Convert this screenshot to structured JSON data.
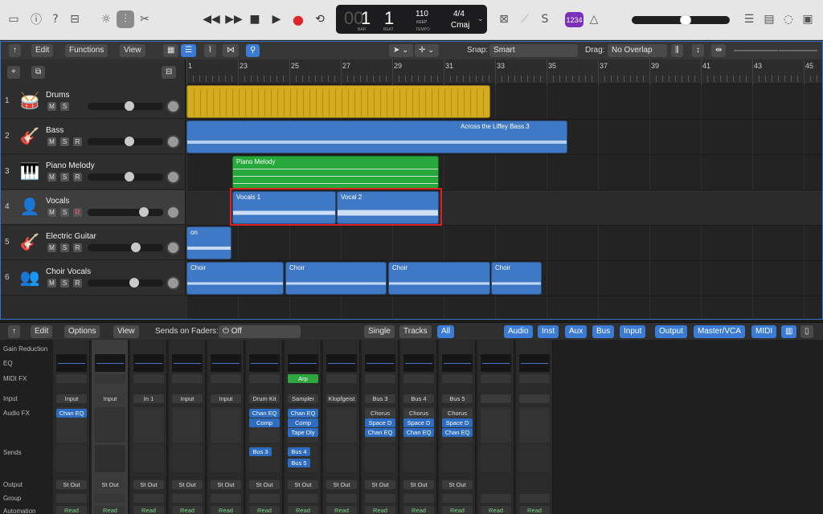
{
  "transport": {
    "bar": "1",
    "beat": "1",
    "bar_dim": "00",
    "bar_label": "BAR",
    "beat_label": "BEAT",
    "tempo": "110",
    "tempo_mode": "KEEP",
    "tempo_label": "TEMPO",
    "time_sig": "4/4",
    "key": "Cmaj",
    "count_in": "1234"
  },
  "arrange": {
    "edit": "Edit",
    "functions": "Functions",
    "view": "View",
    "snap_label": "Snap:",
    "snap_value": "Smart",
    "drag_label": "Drag:",
    "drag_value": "No Overlap"
  },
  "ruler": [
    "1",
    "23",
    "25",
    "27",
    "29",
    "31",
    "33",
    "35",
    "37",
    "39",
    "41",
    "43",
    "45"
  ],
  "tracks": [
    {
      "num": "1",
      "name": "Drums",
      "icon": "drum-kit-icon",
      "glyph": "🥁",
      "rec": false
    },
    {
      "num": "2",
      "name": "Bass",
      "icon": "bass-guitar-icon",
      "glyph": "🎸",
      "rec": false
    },
    {
      "num": "3",
      "name": "Piano Melody",
      "icon": "piano-icon",
      "glyph": "🎹",
      "rec": false
    },
    {
      "num": "4",
      "name": "Vocals",
      "icon": "vocalist-icon",
      "glyph": "👤",
      "rec": true
    },
    {
      "num": "5",
      "name": "Electric Guitar",
      "icon": "electric-guitar-icon",
      "glyph": "🎸",
      "rec": false
    },
    {
      "num": "6",
      "name": "Choir Vocals",
      "icon": "choir-icon",
      "glyph": "👥",
      "rec": false
    }
  ],
  "regions": {
    "bass": "Across the Liffey Bass.3",
    "piano": "Piano Melody",
    "vocals1": "Vocals 1",
    "vocal2": "Vocal 2",
    "guitar": "on",
    "choir": [
      "Choir",
      "Choir",
      "Choir",
      "Choir"
    ]
  },
  "mixer": {
    "edit": "Edit",
    "options": "Options",
    "view": "View",
    "sends_on_faders": "Sends on Faders:",
    "sends_value": "Off",
    "filters": [
      "Single",
      "Tracks",
      "All"
    ],
    "types": [
      "Audio",
      "Inst",
      "Aux",
      "Bus",
      "Input",
      "Output",
      "Master/VCA",
      "MIDI"
    ],
    "row_labels": [
      "Gain Reduction",
      "EQ",
      "MIDI FX",
      "Input",
      "Audio FX",
      "Sends",
      "Output",
      "Group",
      "Automation"
    ],
    "strips": [
      {
        "input": "Input",
        "midi": "",
        "fx": [
          "Chan EQ"
        ],
        "sends": [],
        "output": "St Out",
        "auto": "Read"
      },
      {
        "input": "Input",
        "midi": "",
        "fx": [],
        "sends": [],
        "output": "St Out",
        "auto": "Read"
      },
      {
        "input": "In 1",
        "midi": "",
        "fx": [],
        "sends": [],
        "output": "St Out",
        "auto": "Read"
      },
      {
        "input": "Input",
        "midi": "",
        "fx": [],
        "sends": [],
        "output": "St Out",
        "auto": "Read"
      },
      {
        "input": "Input",
        "midi": "",
        "fx": [],
        "sends": [],
        "output": "St Out",
        "auto": "Read"
      },
      {
        "input": "Drum Kit",
        "midi": "",
        "fx": [
          "Chan EQ",
          "Comp"
        ],
        "sends": [
          "Bus 3"
        ],
        "output": "St Out",
        "auto": "Read"
      },
      {
        "input": "Sampler",
        "midi": "Arp",
        "fx": [
          "Chan EQ",
          "Comp",
          "Tape Dly"
        ],
        "sends": [
          "Bus 4",
          "Bus 5"
        ],
        "output": "St Out",
        "auto": "Read"
      },
      {
        "input": "Klopfgeist",
        "midi": "",
        "fx": [],
        "sends": [],
        "output": "St Out",
        "auto": "Read"
      },
      {
        "input": "Bus 3",
        "midi": "",
        "fx": [
          "Chorus",
          "Space D",
          "Chan EQ"
        ],
        "sends": [],
        "output": "St Out",
        "auto": "Read"
      },
      {
        "input": "Bus 4",
        "midi": "",
        "fx": [
          "Chorus",
          "Space D",
          "Chan EQ"
        ],
        "sends": [],
        "output": "St Out",
        "auto": "Read"
      },
      {
        "input": "Bus 5",
        "midi": "",
        "fx": [
          "Chorus",
          "Space D",
          "Chan EQ"
        ],
        "sends": [],
        "output": "St Out",
        "auto": "Read"
      },
      {
        "input": "",
        "midi": "",
        "fx": [],
        "sends": [],
        "output": "",
        "auto": "Read"
      },
      {
        "input": "",
        "midi": "",
        "fx": [],
        "sends": [],
        "output": "",
        "auto": "Read"
      }
    ]
  },
  "colors": {
    "drums": "#d4aa1e",
    "audio": "#3f78c4",
    "midi": "#27a83a",
    "selection": "#e02020",
    "accent": "#3a7bd5"
  }
}
